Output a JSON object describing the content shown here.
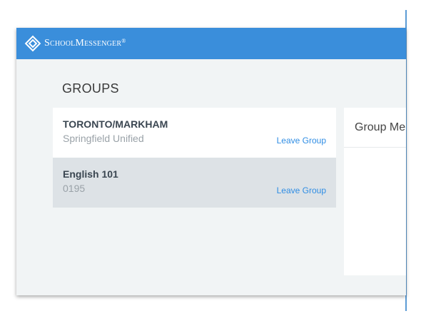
{
  "app": {
    "brand": "SchoolMessenger",
    "brand_mark": "®",
    "logo_icon": "schoolmessenger-logo-icon",
    "accent_color": "#3a8edb"
  },
  "page": {
    "title": "GROUPS"
  },
  "groups": [
    {
      "name": "TORONTO/MARKHAM",
      "subtitle": "Springfield Unified",
      "action": "Leave Group"
    },
    {
      "name": "English 101",
      "subtitle": "0195",
      "action": "Leave Group"
    }
  ],
  "members_panel": {
    "header": "Group Me"
  }
}
